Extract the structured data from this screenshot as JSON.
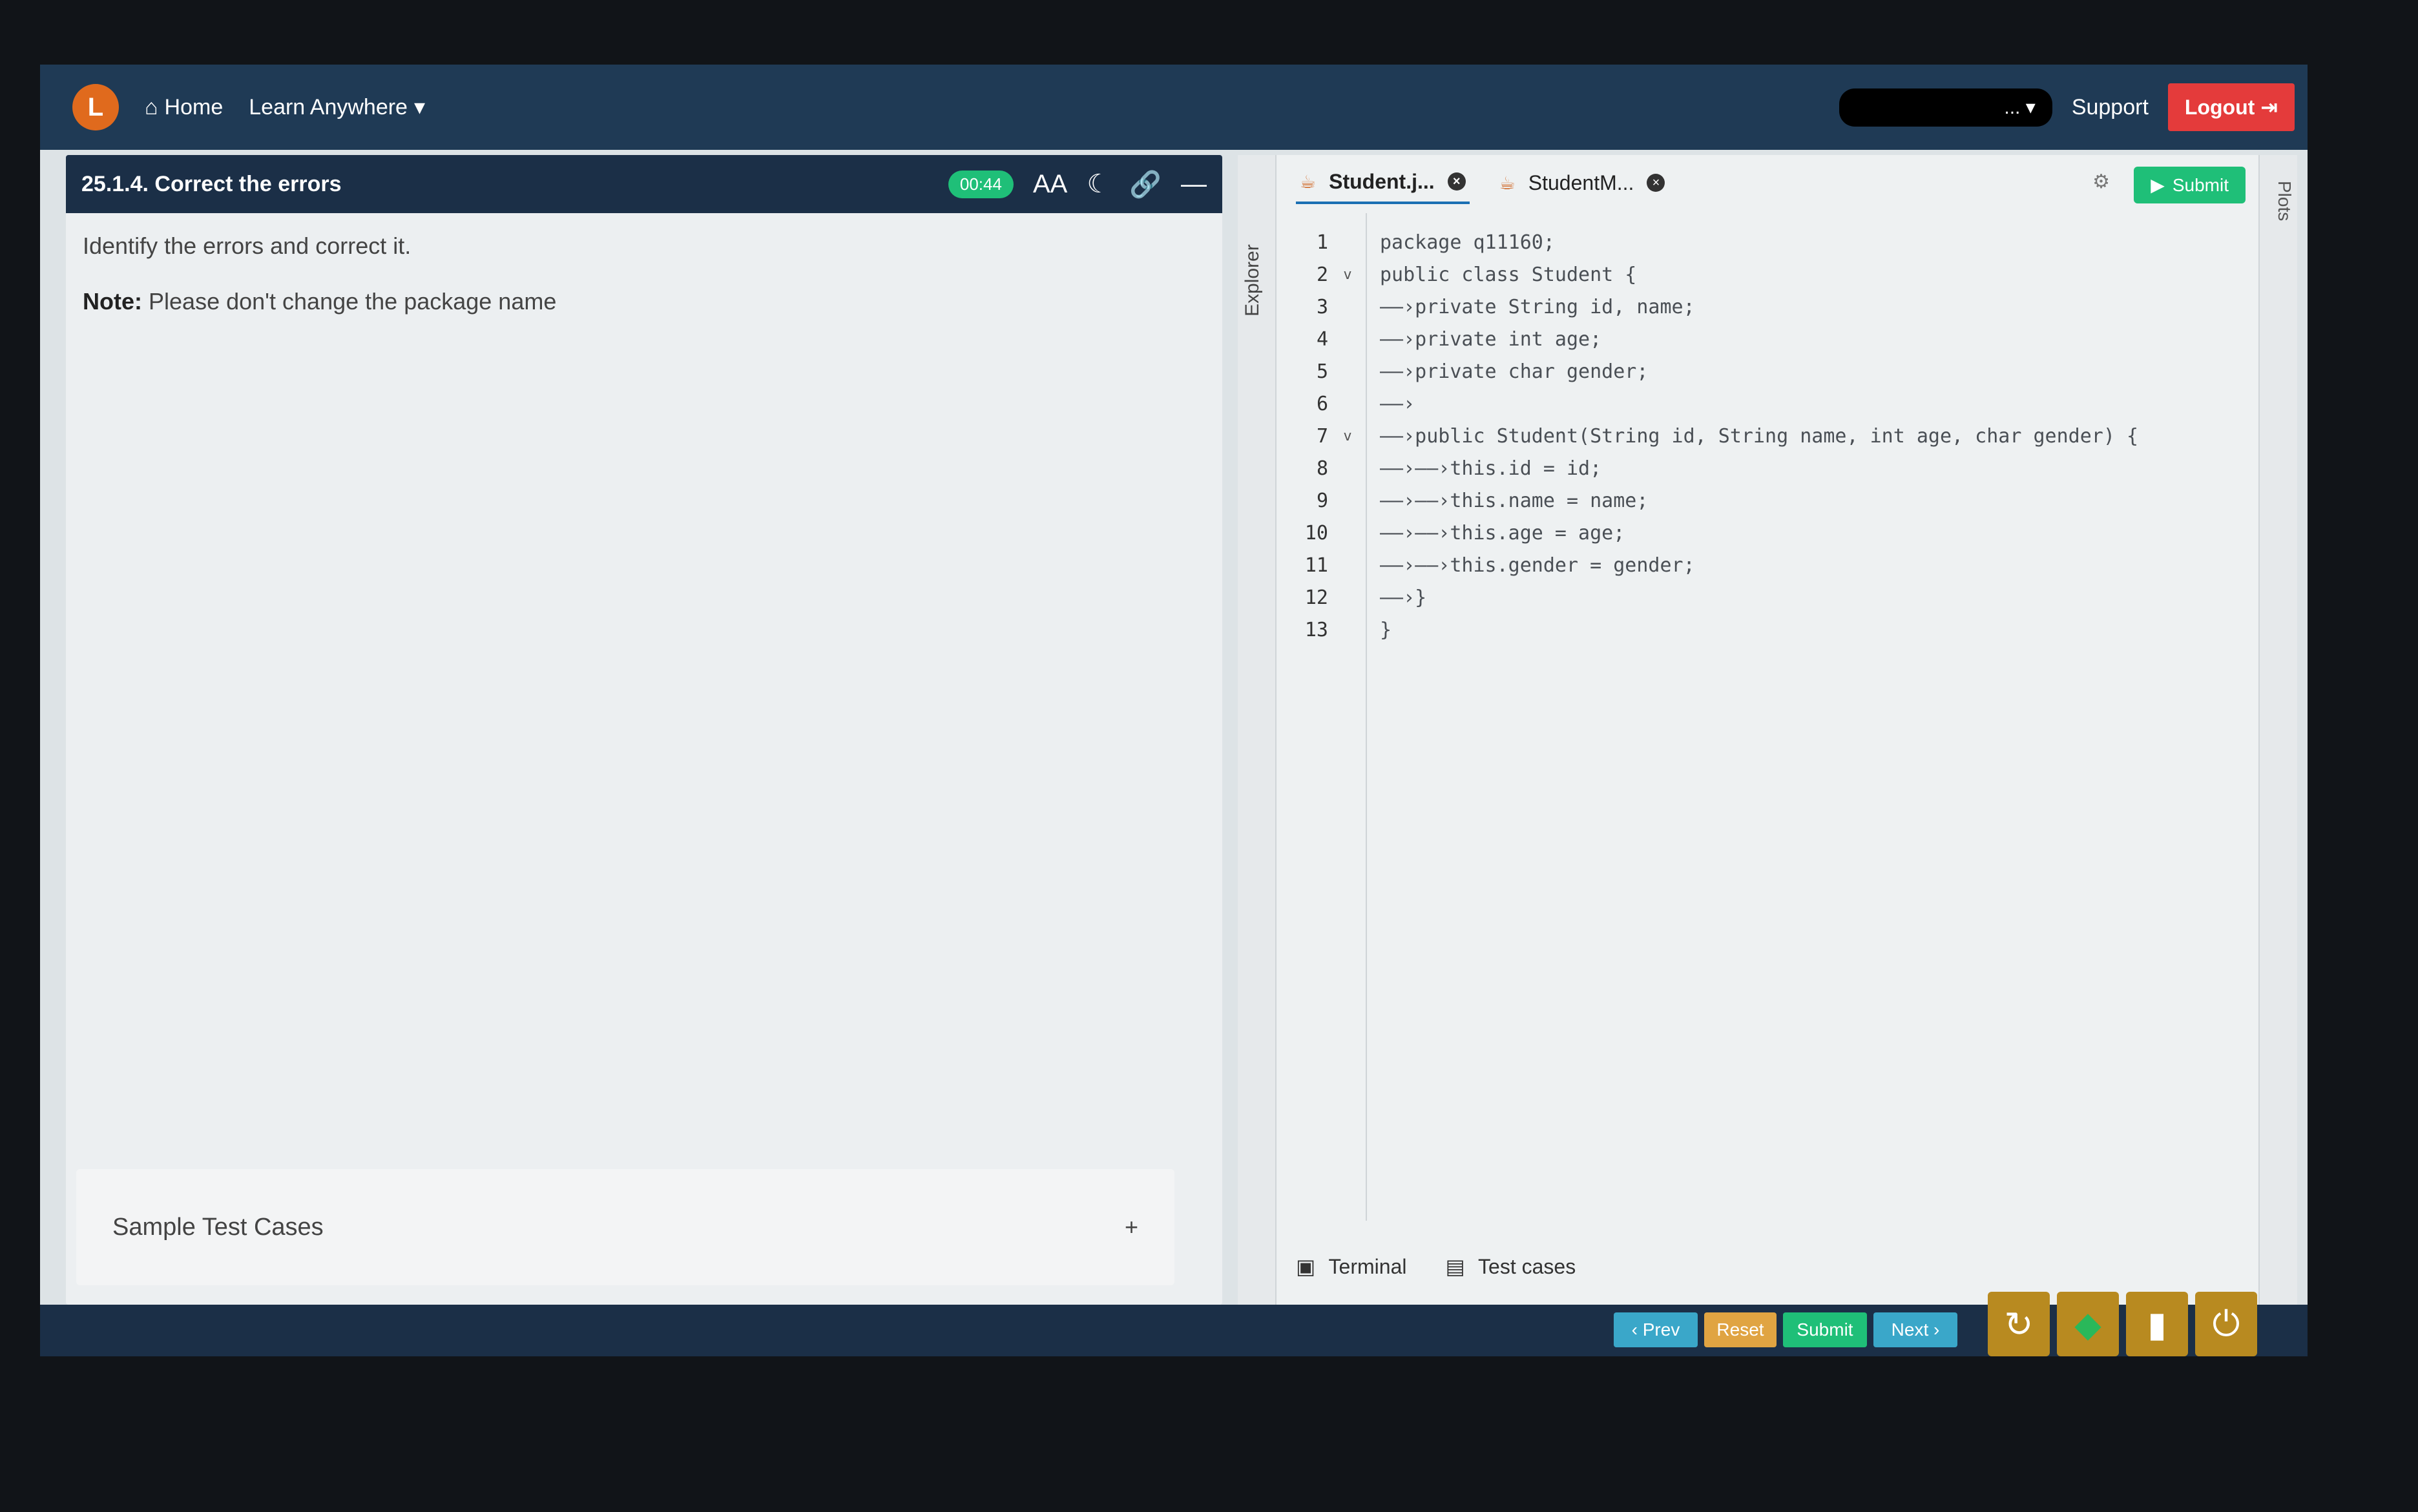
{
  "nav": {
    "logo": "L",
    "home": "Home",
    "learn_anywhere": "Learn Anywhere",
    "user": "...",
    "support": "Support",
    "logout": "Logout"
  },
  "question": {
    "title": "25.1.4. Correct the errors",
    "timer": "00:44",
    "font_tool": "AA",
    "description": "Identify the errors and correct it.",
    "note_label": "Note:",
    "note_text": "Please don't change the package name",
    "sample_test_cases": "Sample Test Cases",
    "plus": "+"
  },
  "editor": {
    "explorer_label": "Explorer",
    "plots_label": "Plots",
    "submit_label": "Submit",
    "tabs": [
      {
        "label": "Student.j...",
        "active": true
      },
      {
        "label": "StudentM...",
        "active": false
      }
    ],
    "lines": [
      {
        "n": "1",
        "fold": "",
        "text": "package q11160;"
      },
      {
        "n": "2",
        "fold": "v",
        "text": "public class Student {"
      },
      {
        "n": "3",
        "fold": "",
        "text": "——›private String id, name;"
      },
      {
        "n": "4",
        "fold": "",
        "text": "——›private int age;"
      },
      {
        "n": "5",
        "fold": "",
        "text": "——›private char gender;"
      },
      {
        "n": "6",
        "fold": "",
        "text": "——›"
      },
      {
        "n": "7",
        "fold": "v",
        "text": "——›public Student(String id, String name, int age, char gender) {"
      },
      {
        "n": "8",
        "fold": "",
        "text": "——›——›this.id = id;"
      },
      {
        "n": "9",
        "fold": "",
        "text": "——›——›this.name = name;"
      },
      {
        "n": "10",
        "fold": "",
        "text": "——›——›this.age = age;"
      },
      {
        "n": "11",
        "fold": "",
        "text": "——›——›this.gender = gender;"
      },
      {
        "n": "12",
        "fold": "",
        "text": "——›}"
      },
      {
        "n": "13",
        "fold": "",
        "text": "}"
      }
    ],
    "bottom_tabs": {
      "terminal": "Terminal",
      "test_cases": "Test cases"
    }
  },
  "actions": {
    "prev": "‹ Prev",
    "reset": "Reset",
    "submit": "Submit",
    "next": "Next ›"
  },
  "colors": {
    "nav_bg": "#1f3a55",
    "header_bg": "#1b2f47",
    "timer_green": "#1fbf78",
    "logout_red": "#e43b3b",
    "reset_orange": "#e0a442",
    "prev_next_blue": "#3aa7c9"
  }
}
